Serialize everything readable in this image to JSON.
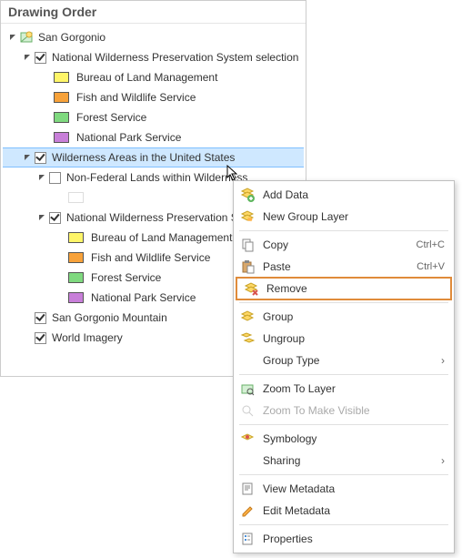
{
  "panel": {
    "title": "Drawing Order"
  },
  "tree": {
    "root": {
      "label": "San Gorgonio"
    },
    "g1": {
      "label": "National Wilderness Preservation System selection",
      "children": [
        {
          "label": "Bureau of Land Management",
          "color": "#fef568"
        },
        {
          "label": "Fish and Wildlife Service",
          "color": "#f7a23a"
        },
        {
          "label": "Forest Service",
          "color": "#7fd97f"
        },
        {
          "label": "National Park Service",
          "color": "#c87fd9"
        }
      ]
    },
    "g2": {
      "label": "Wilderness Areas in the United States"
    },
    "g2a": {
      "label": "Non-Federal Lands within Wilderness",
      "children": [
        {
          "label": "",
          "color": "#ffffff"
        }
      ]
    },
    "g2b": {
      "label": "National Wilderness Preservation Syste",
      "children": [
        {
          "label": "Bureau of Land Management",
          "color": "#fef568"
        },
        {
          "label": "Fish and Wildlife Service",
          "color": "#f7a23a"
        },
        {
          "label": "Forest Service",
          "color": "#7fd97f"
        },
        {
          "label": "National Park Service",
          "color": "#c87fd9"
        }
      ]
    },
    "g3": {
      "label": "San Gorgonio Mountain"
    },
    "g4": {
      "label": "World Imagery"
    }
  },
  "menu": {
    "add_data": "Add Data",
    "new_group_layer": "New Group Layer",
    "copy": "Copy",
    "copy_sc": "Ctrl+C",
    "paste": "Paste",
    "paste_sc": "Ctrl+V",
    "remove": "Remove",
    "group": "Group",
    "ungroup": "Ungroup",
    "group_type": "Group Type",
    "zoom_to_layer": "Zoom To Layer",
    "zoom_make_visible": "Zoom To Make Visible",
    "symbology": "Symbology",
    "sharing": "Sharing",
    "view_metadata": "View Metadata",
    "edit_metadata": "Edit Metadata",
    "properties": "Properties"
  }
}
